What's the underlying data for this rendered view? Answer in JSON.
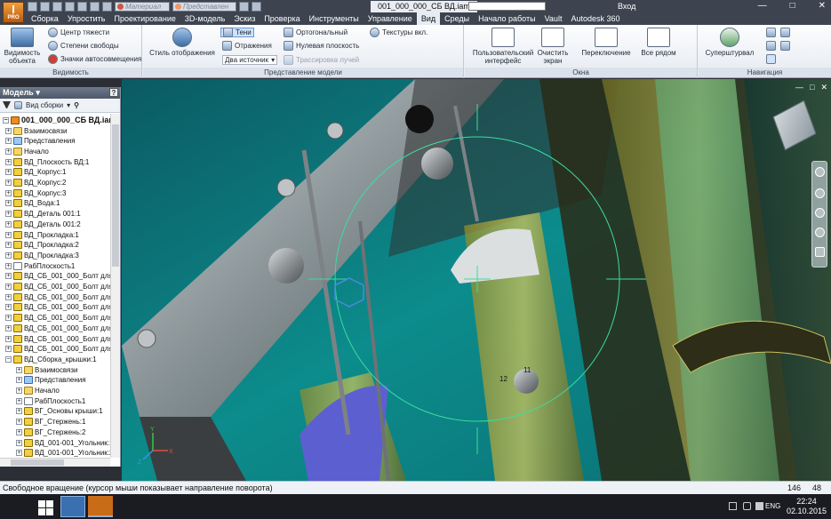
{
  "app": {
    "logo": "I",
    "logo_sub": "PRO"
  },
  "quick_access": {
    "material": "Материал",
    "appearance": "Представлен"
  },
  "title": {
    "document": "001_000_000_СБ ВД.iam",
    "signin": "Вход"
  },
  "window_controls": {
    "min": "—",
    "max": "□",
    "close": "✕"
  },
  "menu_tabs": [
    "Сборка",
    "Упростить",
    "Проектирование",
    "3D-модель",
    "Эскиз",
    "Проверка",
    "Инструменты",
    "Управление",
    "Вид",
    "Среды",
    "Начало работы",
    "Vault",
    "Autodesk 360"
  ],
  "active_tab": "Вид",
  "ribbon": {
    "visibility": {
      "label": "Видимость",
      "object_visibility": "Видимость объекта",
      "center_of_gravity": "Центр тяжести",
      "dof": "Степени свободы",
      "auto_icons": "Значки автосовмещения"
    },
    "representation": {
      "label": "Представление модели",
      "visual_style": "Стиль отображения",
      "shadows": "Тени",
      "reflections": "Отражения",
      "two_light": "Два источник",
      "orthographic": "Ортогональный",
      "ground_plane": "Нулевая плоскость",
      "ray_tracing": "Трассировка лучей",
      "textures": "Текстуры вкл."
    },
    "windows": {
      "label": "Окна",
      "user_interface": "Пользовательский интерфейс",
      "clean_screen": "Очистить экран",
      "switch": "Переключение",
      "tile": "Все рядом"
    },
    "navigation": {
      "label": "Навигация",
      "steering_wheel": "Суперштурвал"
    }
  },
  "browser": {
    "title": "Модель",
    "view": "Вид сборки",
    "help": "?",
    "root": "001_000_000_СБ ВД.iam",
    "items": [
      {
        "label": "Взаимосвязи",
        "icon": "folder",
        "level": 0
      },
      {
        "label": "Представления",
        "icon": "view",
        "level": 0
      },
      {
        "label": "Начало",
        "icon": "folder",
        "level": 0
      },
      {
        "label": "ВД_Плоскость ВД:1",
        "icon": "part",
        "level": 0
      },
      {
        "label": "ВД_Корпус:1",
        "icon": "part",
        "level": 0
      },
      {
        "label": "ВД_Корпус:2",
        "icon": "part",
        "level": 0
      },
      {
        "label": "ВД_Корпус:3",
        "icon": "part",
        "level": 0
      },
      {
        "label": "ВД_Вода:1",
        "icon": "part",
        "level": 0
      },
      {
        "label": "ВД_Деталь 001:1",
        "icon": "part",
        "level": 0
      },
      {
        "label": "ВД_Деталь 001:2",
        "icon": "part",
        "level": 0
      },
      {
        "label": "ВД_Прокладка:1",
        "icon": "part",
        "level": 0
      },
      {
        "label": "ВД_Прокладка:2",
        "icon": "part",
        "level": 0
      },
      {
        "label": "ВД_Прокладка:3",
        "icon": "part",
        "level": 0
      },
      {
        "label": "РабПлоскость1",
        "icon": "plane",
        "level": 0
      },
      {
        "label": "ВД_СБ_001_000_Болт для со",
        "icon": "part",
        "level": 0
      },
      {
        "label": "ВД_СБ_001_000_Болт для со",
        "icon": "part",
        "level": 0
      },
      {
        "label": "ВД_СБ_001_000_Болт для со",
        "icon": "part",
        "level": 0
      },
      {
        "label": "ВД_СБ_001_000_Болт для со",
        "icon": "part",
        "level": 0
      },
      {
        "label": "ВД_СБ_001_000_Болт для со",
        "icon": "part",
        "level": 0
      },
      {
        "label": "ВД_СБ_001_000_Болт для со",
        "icon": "part",
        "level": 0
      },
      {
        "label": "ВД_СБ_001_000_Болт для со",
        "icon": "part",
        "level": 0
      },
      {
        "label": "ВД_СБ_001_000_Болт для со",
        "icon": "part",
        "level": 0
      },
      {
        "label": "ВД_Сборка_крышки:1",
        "icon": "part",
        "level": 0
      },
      {
        "label": "Взаимосвязи",
        "icon": "folder",
        "level": 1
      },
      {
        "label": "Представления",
        "icon": "view",
        "level": 1
      },
      {
        "label": "Начало",
        "icon": "folder",
        "level": 1
      },
      {
        "label": "РабПлоскость1",
        "icon": "plane",
        "level": 1
      },
      {
        "label": "ВГ_Основы крыши:1",
        "icon": "part",
        "level": 1
      },
      {
        "label": "ВГ_Стержень:1",
        "icon": "part",
        "level": 1
      },
      {
        "label": "ВГ_Стержень:2",
        "icon": "part",
        "level": 1
      },
      {
        "label": "ВД_001-001_Угольник:1",
        "icon": "part",
        "level": 1
      },
      {
        "label": "ВД_001-001_Угольник:2",
        "icon": "part",
        "level": 1
      }
    ]
  },
  "viewport": {
    "dim1": "11",
    "dim2": "12",
    "axis_x": "X",
    "axis_y": "Y",
    "axis_z": "Z"
  },
  "status": {
    "text": "Свободное вращение (курсор мыши показывает направление поворота)",
    "n1": "146",
    "n2": "48"
  },
  "taskbar": {
    "lang": "ENG",
    "time": "22:24",
    "date": "02.10.2015"
  }
}
